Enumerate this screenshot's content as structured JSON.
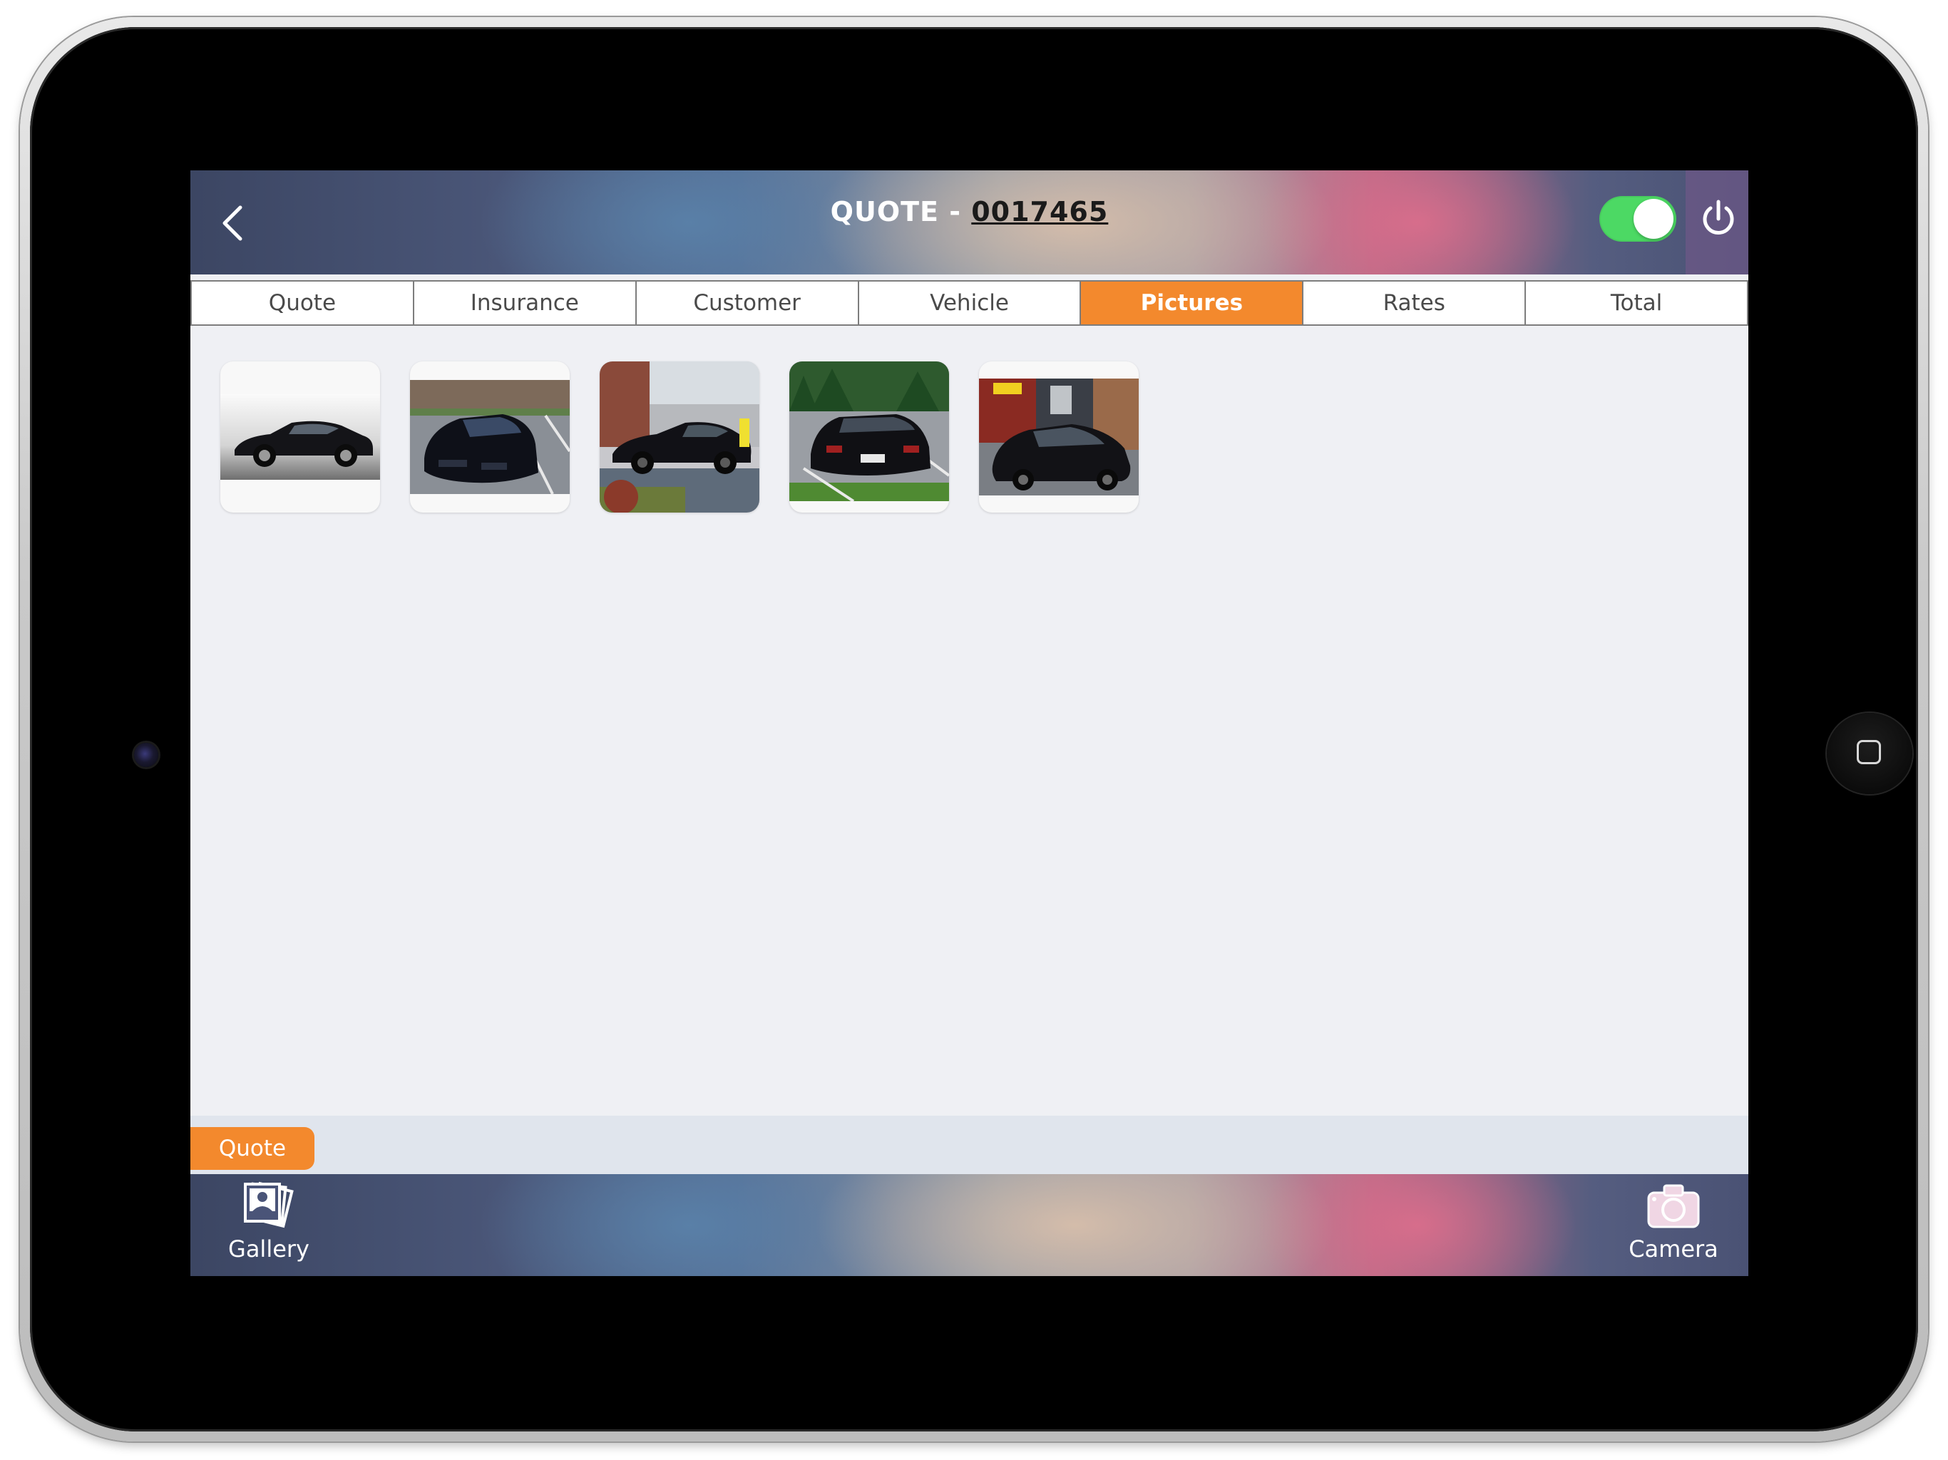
{
  "header": {
    "title_prefix": "QUOTE - ",
    "quote_number": "0017465",
    "toggle_on": true,
    "toggle_color": "#4cd964"
  },
  "tabs": [
    {
      "label": "Quote",
      "active": false
    },
    {
      "label": "Insurance",
      "active": false
    },
    {
      "label": "Customer",
      "active": false
    },
    {
      "label": "Vehicle",
      "active": false
    },
    {
      "label": "Pictures",
      "active": true
    },
    {
      "label": "Rates",
      "active": false
    },
    {
      "label": "Total",
      "active": false
    }
  ],
  "pictures": [
    {
      "subject": "black sedan on white studio background"
    },
    {
      "subject": "black sedan front view in parking lot"
    },
    {
      "subject": "black sedan side view on street"
    },
    {
      "subject": "black sedan rear view in parking lot"
    },
    {
      "subject": "black sedan in front of storefront"
    }
  ],
  "quote_strip": {
    "label": "Quote"
  },
  "toolbar": {
    "gallery_label": "Gallery",
    "camera_label": "Camera"
  },
  "colors": {
    "accent": "#f3892d",
    "screen_bg": "#eff0f4"
  }
}
